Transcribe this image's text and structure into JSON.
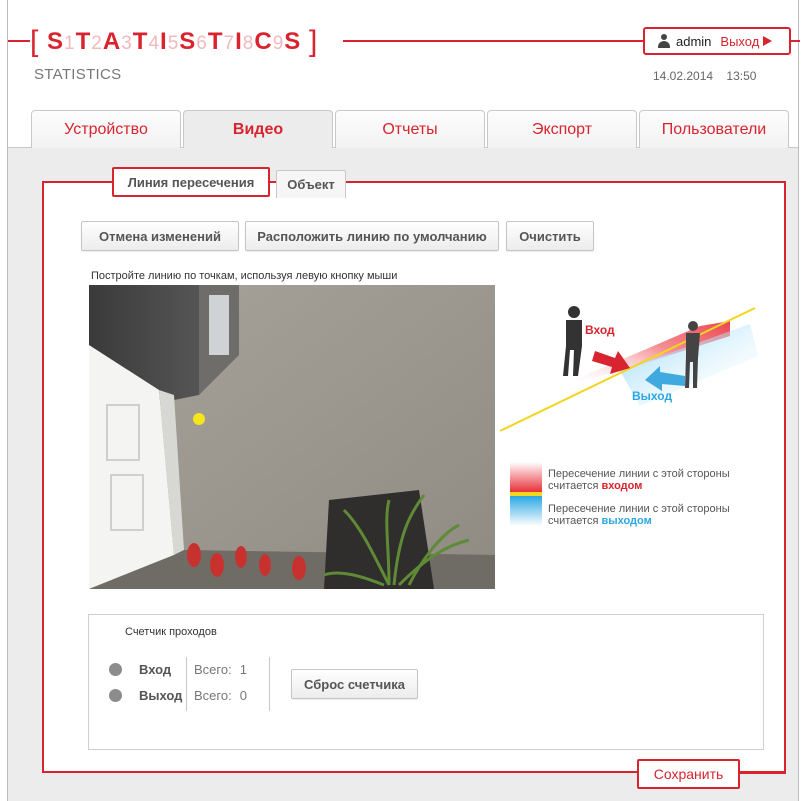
{
  "header": {
    "logo": {
      "bracket_open": "[",
      "bracket_close": "]",
      "chars": [
        {
          "l": "S",
          "n": "1"
        },
        {
          "l": "T",
          "n": "2"
        },
        {
          "l": "A",
          "n": "3"
        },
        {
          "l": "T",
          "n": "4"
        },
        {
          "l": "I",
          "n": "5"
        },
        {
          "l": "S",
          "n": "6"
        },
        {
          "l": "T",
          "n": "7"
        },
        {
          "l": "I",
          "n": "8"
        },
        {
          "l": "C",
          "n": "9"
        },
        {
          "l": "S",
          "n": ""
        }
      ]
    },
    "subtitle": "STATISTICS",
    "user": {
      "name": "admin",
      "logout_label": "Выход",
      "icon": "user-icon",
      "logout_icon": "play-icon"
    },
    "date": "14.02.2014",
    "time": "13:50"
  },
  "tabs": [
    {
      "label": "Устройство",
      "active": false
    },
    {
      "label": "Видео",
      "active": true
    },
    {
      "label": "Отчеты",
      "active": false
    },
    {
      "label": "Экспорт",
      "active": false
    },
    {
      "label": "Пользователи",
      "active": false
    }
  ],
  "subtabs": {
    "line": "Линия пересечения",
    "object": "Объект"
  },
  "toolbar": {
    "cancel_label": "Отмена изменений",
    "default_line_label": "Расположить линию по умолчанию",
    "clear_label": "Очистить"
  },
  "hint": "Постройте линию по точкам, используя левую кнопку мыши",
  "diagram": {
    "entry_label": "Вход",
    "exit_label": "Выход"
  },
  "legend": {
    "entry_text": "Пересечение линии с этой стороны",
    "entry_prefix": "считается",
    "entry_word": "входом",
    "exit_text": "Пересечение линии с этой стороны",
    "exit_prefix": "считается",
    "exit_word": "выходом"
  },
  "counter": {
    "title": "Счетчик проходов",
    "rows": [
      {
        "label": "Вход",
        "total_label": "Всего:",
        "value": "1"
      },
      {
        "label": "Выход",
        "total_label": "Всего:",
        "value": "0"
      }
    ],
    "reset_label": "Сброс счетчика"
  },
  "save_label": "Сохранить",
  "colors": {
    "accent": "#d9232e",
    "entry": "#e8303a",
    "exit": "#2aa7e3",
    "line": "#f2d51e"
  }
}
